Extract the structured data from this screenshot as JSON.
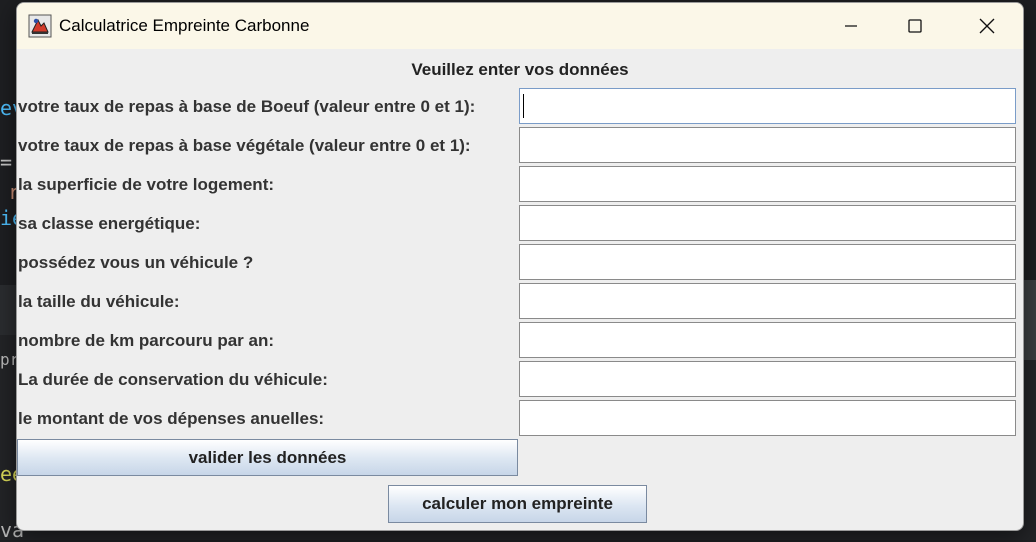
{
  "window": {
    "title": "Calculatrice Empreinte Carbonne"
  },
  "form": {
    "heading": "Veuillez enter vos données",
    "fields": [
      {
        "label": "votre taux de repas à base de Boeuf (valeur entre 0 et 1):",
        "value": ""
      },
      {
        "label": "votre taux de repas à base végétale (valeur entre 0 et 1):",
        "value": ""
      },
      {
        "label": "la superficie de votre logement:",
        "value": ""
      },
      {
        "label": "sa classe energétique:",
        "value": ""
      },
      {
        "label": "possédez vous un véhicule ?",
        "value": ""
      },
      {
        "label": "la taille du véhicule:",
        "value": ""
      },
      {
        "label": "nombre de km parcouru par an:",
        "value": ""
      },
      {
        "label": "La durée de conservation du véhicule:",
        "value": ""
      },
      {
        "label": "le montant de vos dépenses anuelles:",
        "value": ""
      }
    ],
    "validate_label": "valider les données",
    "calculate_label": "calculer mon empreinte"
  },
  "background": {
    "code_fragments": [
      "ev",
      "=",
      "r",
      "ie",
      "pr",
      "ee",
      "va"
    ]
  },
  "colors": {
    "window_bg": "#eeeeee",
    "titlebar_bg": "#fbf7e8",
    "button_gradient_bottom": "#c7d6e8"
  }
}
